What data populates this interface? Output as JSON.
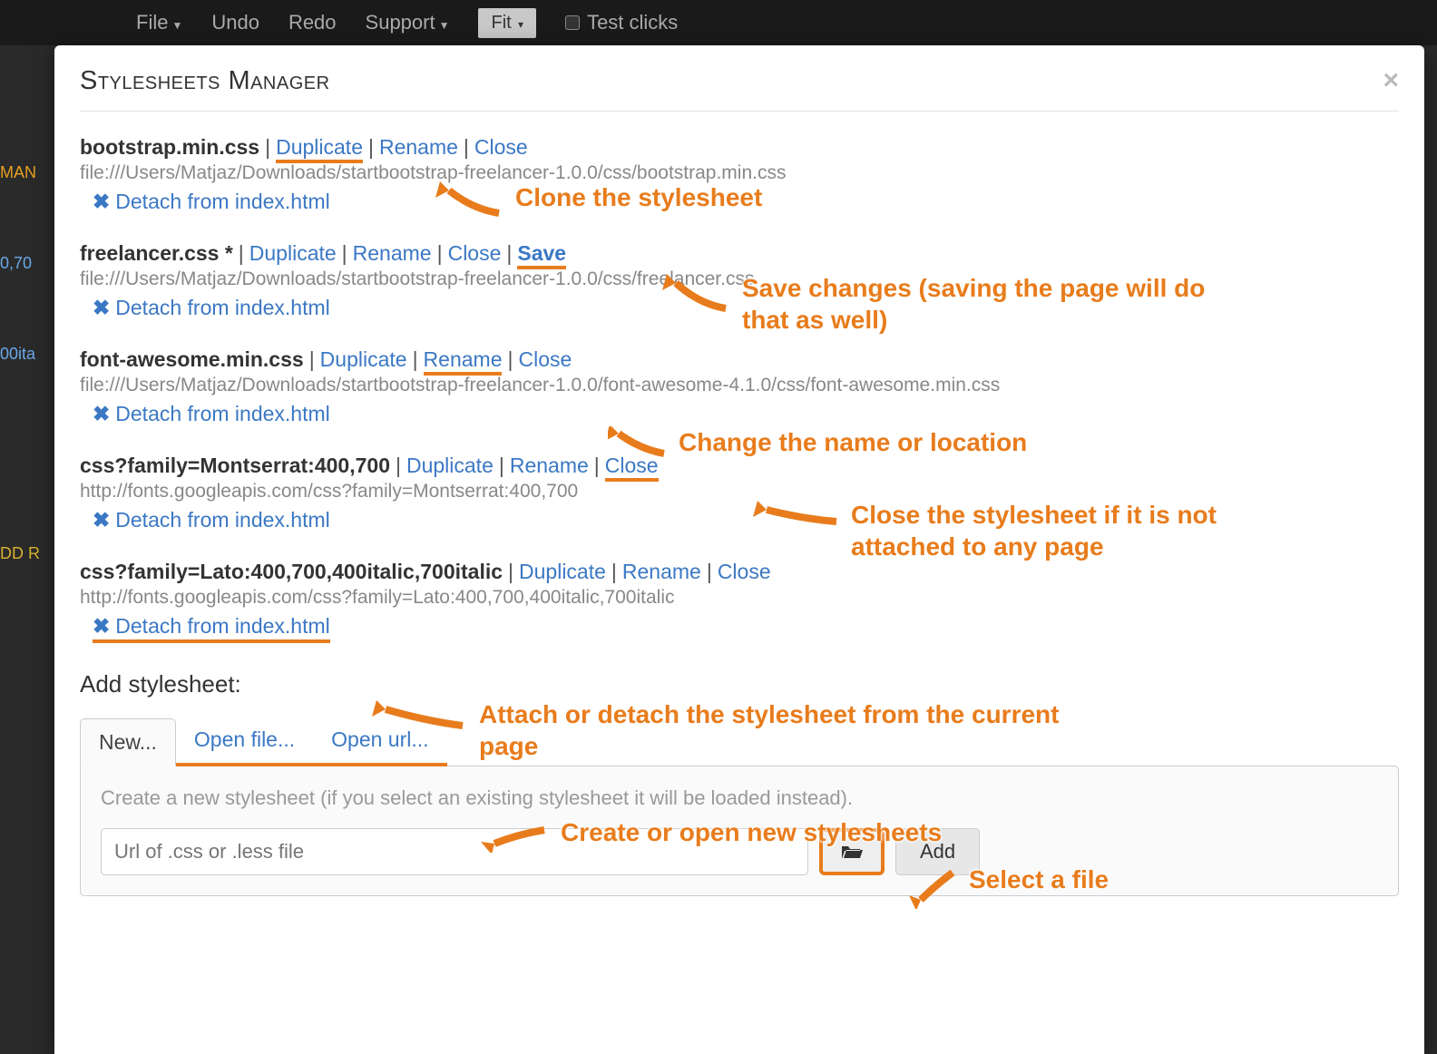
{
  "topbar": {
    "file": "File",
    "undo": "Undo",
    "redo": "Redo",
    "support": "Support",
    "fit": "Fit",
    "test_clicks": "Test clicks"
  },
  "side": {
    "h1": "MAN",
    "h2": "0,70",
    "h3": "00ita",
    "h4": "DD R"
  },
  "modal": {
    "title": "Stylesheets Manager",
    "close": "×"
  },
  "actions": {
    "duplicate": "Duplicate",
    "rename": "Rename",
    "close": "Close",
    "save": "Save",
    "detach": "Detach from index.html"
  },
  "sheets": [
    {
      "name": "bootstrap.min.css",
      "path": "file:///Users/Matjaz/Downloads/startbootstrap-freelancer-1.0.0/css/bootstrap.min.css",
      "modified": false,
      "underline": "duplicate"
    },
    {
      "name": "freelancer.css",
      "path": "file:///Users/Matjaz/Downloads/startbootstrap-freelancer-1.0.0/css/freelancer.css",
      "modified": true,
      "underline": "save"
    },
    {
      "name": "font-awesome.min.css",
      "path": "file:///Users/Matjaz/Downloads/startbootstrap-freelancer-1.0.0/font-awesome-4.1.0/css/font-awesome.min.css",
      "modified": false,
      "underline": "rename"
    },
    {
      "name": "css?family=Montserrat:400,700",
      "path": "http://fonts.googleapis.com/css?family=Montserrat:400,700",
      "modified": false,
      "underline": "close"
    },
    {
      "name": "css?family=Lato:400,700,400italic,700italic",
      "path": "http://fonts.googleapis.com/css?family=Lato:400,700,400italic,700italic",
      "modified": false,
      "underline": "detach"
    }
  ],
  "add": {
    "title": "Add stylesheet:",
    "tab_new": "New...",
    "tab_open_file": "Open file...",
    "tab_open_url": "Open url...",
    "desc": "Create a new stylesheet (if you select an existing stylesheet it will be loaded instead).",
    "placeholder": "Url of .css or .less file",
    "add_btn": "Add"
  },
  "annotations": {
    "clone": "Clone the stylesheet",
    "save": "Save changes (saving the page will do that as well)",
    "rename": "Change the name or location",
    "close": "Close the stylesheet if it is not attached to any page",
    "detach": "Attach or detach the stylesheet from the current page",
    "create": "Create or open new stylesheets",
    "select": "Select a file"
  }
}
